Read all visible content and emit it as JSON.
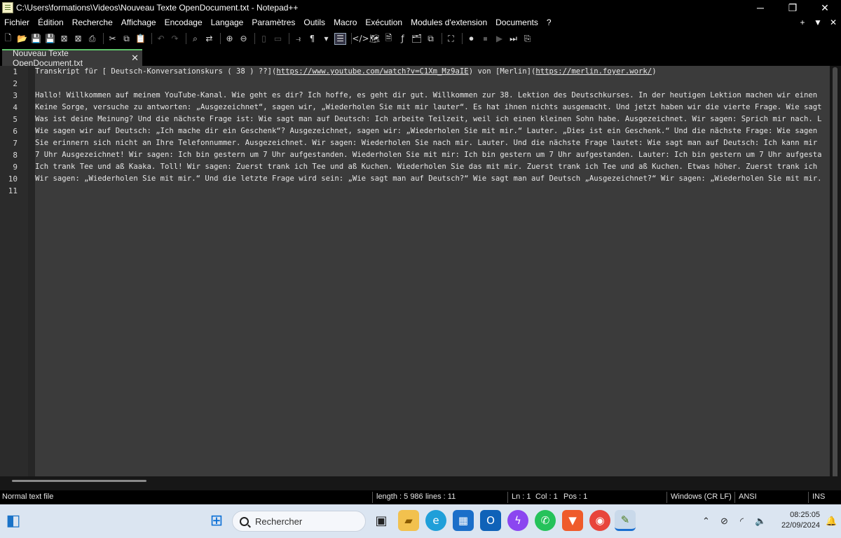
{
  "window": {
    "title": "C:\\Users\\formations\\Videos\\Nouveau Texte OpenDocument.txt - Notepad++",
    "minimize": "─",
    "maximize": "❐",
    "close": "✕"
  },
  "menu": {
    "items": [
      "Fichier",
      "Édition",
      "Recherche",
      "Affichage",
      "Encodage",
      "Langage",
      "Paramètres",
      "Outils",
      "Macro",
      "Exécution",
      "Modules d'extension",
      "Documents",
      "?"
    ],
    "right": [
      "+",
      "▼",
      "✕"
    ]
  },
  "tab": {
    "label": "Nouveau Texte OpenDocument.txt",
    "close": "✕"
  },
  "editor": {
    "line_numbers": [
      "1",
      "2",
      "3",
      "4",
      "5",
      "6",
      "7",
      "8",
      "9",
      "10",
      "11"
    ],
    "line1": {
      "a": "Transkript für [ Deutsch-Konversationskurs ( 38 ) ??](",
      "link1": "https://www.youtube.com/watch?v=C1Xm_Mz9aIE",
      "b": ") von [Merlin](",
      "link2": "https://merlin.foyer.work/",
      "c": ")"
    },
    "lines": [
      "",
      "Hallo! Willkommen auf meinem YouTube-Kanal. Wie geht es dir? Ich hoffe, es geht dir gut. Willkommen zur 38. Lektion des Deutschkurses. In der heutigen Lektion machen wir einen",
      "Keine Sorge, versuche zu antworten: „Ausgezeichnet“, sagen wir, „Wiederholen Sie mit mir lauter“. Es hat ihnen nichts ausgemacht. Und jetzt haben wir die vierte Frage. Wie sagt",
      "Was ist deine Meinung? Und die nächste Frage ist: Wie sagt man auf Deutsch: Ich arbeite Teilzeit, weil ich einen kleinen Sohn habe. Ausgezeichnet. Wir sagen: Sprich mir nach. L",
      "Wie sagen wir auf Deutsch: „Ich mache dir ein Geschenk“? Ausgezeichnet, sagen wir: „Wiederholen Sie mit mir.“ Lauter. „Dies ist ein Geschenk.“ Und die nächste Frage: Wie sagen",
      "Sie erinnern sich nicht an Ihre Telefonnummer. Ausgezeichnet. Wir sagen: Wiederholen Sie nach mir. Lauter. Und die nächste Frage lautet: Wie sagt man auf Deutsch: Ich kann mir",
      "7 Uhr Ausgezeichnet! Wir sagen: Ich bin gestern um 7 Uhr aufgestanden. Wiederholen Sie mit mir: Ich bin gestern um 7 Uhr aufgestanden. Lauter: Ich bin gestern um 7 Uhr aufgesta",
      "Ich trank Tee und aß Kaaka. Toll! Wir sagen: Zuerst trank ich Tee und aß Kuchen. Wiederholen Sie das mit mir. Zuerst trank ich Tee und aß Kuchen. Etwas höher. Zuerst trank ich",
      "Wir sagen: „Wiederholen Sie mit mir.“ Und die letzte Frage wird sein: „Wie sagt man auf Deutsch?“ Wie sagt man auf Deutsch „Ausgezeichnet?“ Wir sagen: „Wiederholen Sie mit mir.",
      ""
    ]
  },
  "status": {
    "type": "Normal text file",
    "length": "length : 5 986",
    "lines": "lines : 11",
    "ln": "Ln : 1",
    "col": "Col : 1",
    "pos": "Pos : 1",
    "eol": "Windows (CR LF)",
    "encoding": "ANSI",
    "mode": "INS"
  },
  "taskbar": {
    "search_placeholder": "Rechercher",
    "time": "08:25:05",
    "date": "22/09/2024"
  }
}
